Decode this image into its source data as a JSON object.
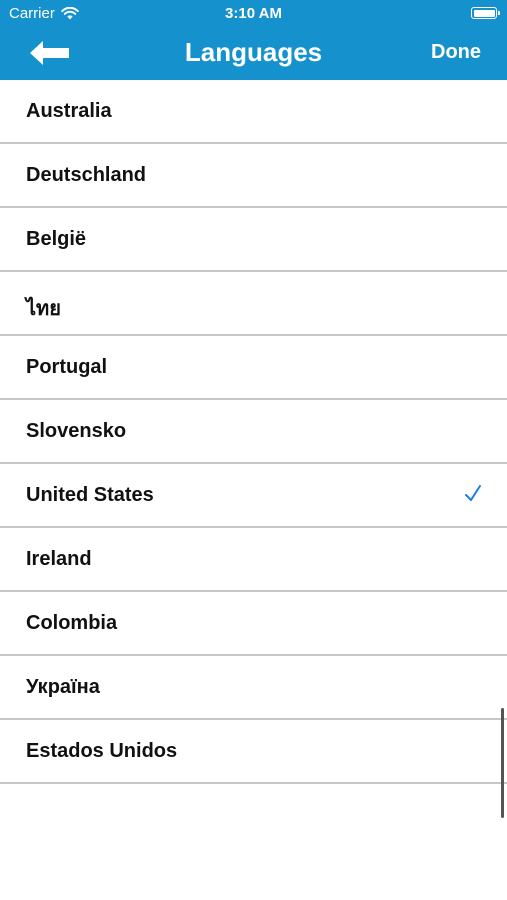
{
  "status_bar": {
    "carrier": "Carrier",
    "time": "3:10 AM"
  },
  "nav": {
    "title": "Languages",
    "done_label": "Done",
    "back_icon": "arrow-left-icon"
  },
  "colors": {
    "nav_background": "#1592cd",
    "checkmark": "#1a7fe0",
    "separator": "#c7c7cc"
  },
  "languages": [
    {
      "label": "Australia",
      "selected": false
    },
    {
      "label": "Deutschland",
      "selected": false
    },
    {
      "label": "België",
      "selected": false
    },
    {
      "label": "ไทย",
      "selected": false
    },
    {
      "label": "Portugal",
      "selected": false
    },
    {
      "label": "Slovensko",
      "selected": false
    },
    {
      "label": "United States",
      "selected": true
    },
    {
      "label": "Ireland",
      "selected": false
    },
    {
      "label": "Colombia",
      "selected": false
    },
    {
      "label": "Україна",
      "selected": false
    },
    {
      "label": "Estados Unidos",
      "selected": false
    }
  ]
}
